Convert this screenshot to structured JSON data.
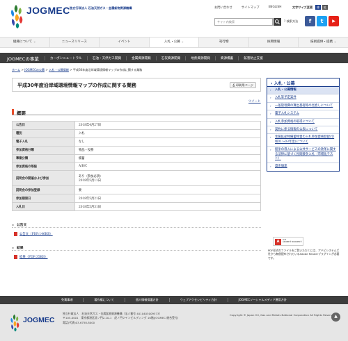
{
  "header": {
    "brand": "JOGMEC",
    "org_name": "独立行政法人 石油天然ガス・金属鉱物資源機構",
    "top_links": [
      "お問い合わせ",
      "サイトマップ",
      "ENGLISH"
    ],
    "font_size_label": "文字サイズ変更",
    "font_size_options": [
      "標準",
      "拡大"
    ],
    "search_placeholder": "サイト内検索",
    "advanced_search": "検索方法",
    "social": [
      "f",
      "t",
      "▶"
    ],
    "colors": {
      "brand": "#1a3d8c",
      "facebook": "#3b5998",
      "twitter": "#1da1f2",
      "youtube": "#e62117"
    }
  },
  "gnav": [
    "組織について",
    "ニュースリリース",
    "イベント",
    "入札・公募",
    "刊行物",
    "採用情報",
    "技術提供・提携"
  ],
  "gnav_active": 3,
  "subnav": {
    "title": "JOGMECの事業",
    "items": [
      "カーボンニュートラル",
      "石油・天然ガス開発",
      "金属資源開発",
      "石炭資源開発",
      "地熱資源開発",
      "資源備蓄",
      "鉱害防止支援"
    ]
  },
  "breadcrumb": {
    "home": "ホーム",
    "sep": ">",
    "items": [
      "JOGMECの公募",
      "入札・公募情報"
    ],
    "current": "平成30年度沿岸域環境情報マップの作成に関する業務"
  },
  "page": {
    "title": "平成30年度沿岸域環境情報マップの作成に関する業務",
    "print_label": "印刷用ページ",
    "tweet": "ツイート"
  },
  "overview": {
    "heading": "概要",
    "rows": [
      {
        "label": "公告日",
        "value": "2018年4月27日"
      },
      {
        "label": "種別",
        "value": "入札"
      },
      {
        "label": "電子入札",
        "value": "なし"
      },
      {
        "label": "参加資格分類",
        "value": "物品・役務"
      },
      {
        "label": "事業分類",
        "value": "備蓄"
      },
      {
        "label": "参加資格の等級",
        "value": "A/B/C"
      },
      {
        "label": "説明会の開催および参加",
        "value": "あり（参加必須）",
        "value2": "2018年5月11日"
      },
      {
        "label": "説明会の参加登録",
        "value": "要"
      },
      {
        "label": "参加期限日",
        "value": "2018年5月21日"
      },
      {
        "label": "入札日",
        "value": "2018年5月31日"
      }
    ]
  },
  "documents": {
    "notice_heading": "公告文",
    "notice_link": "公告文（PDF:146KB）",
    "result_heading": "結果",
    "result_link": "結果（PDF:35KB）"
  },
  "sidebar": {
    "heading": "入札・公募",
    "items": [
      "入札・公募情報",
      "入札等予定案件",
      "一般管理費の算出基礎等の見直しについて",
      "電子入札システム",
      "入札参加資格の取得について",
      "契約に係る情報の公表について",
      "金属鉱産物備蓄物資の入札参加資格登録(令和01～03年度)について",
      "競争の導入による公共サービスの改革に関する法律に基づく民間競争入札（市場化テスト）",
      "資金調達"
    ],
    "current_index": 0,
    "adobe_badge_top": "Get",
    "adobe_badge_bottom": "ADOBE® READER®",
    "adobe_note": "PDF形式のファイルをご覧いただくには、アドビシステムズ社から無償配布されているAdobe Readerプラグインが必要です。"
  },
  "footer": {
    "links": [
      "免責事項",
      "著作権について",
      "個人情報保護方針",
      "ウェブアクセシビリティ方針",
      "JOGMECソーシャルメディア運用方針"
    ],
    "brand": "JOGMEC",
    "address_lines": [
      "独立行政法人　石油天然ガス・金属鉱物資源機構（法人番号 4010405009573）",
      "〒105-0001　東京都港区虎ノ門2-10-1　虎ノ門ツインビルディング 16階(JOGMEC 総合受付)",
      "電話(代表)03-6758-8000"
    ],
    "copyright": "Copyright © Japan Oil, Gas and Metals National Corporation All Rights Reserved.",
    "pagetop": "▲"
  }
}
